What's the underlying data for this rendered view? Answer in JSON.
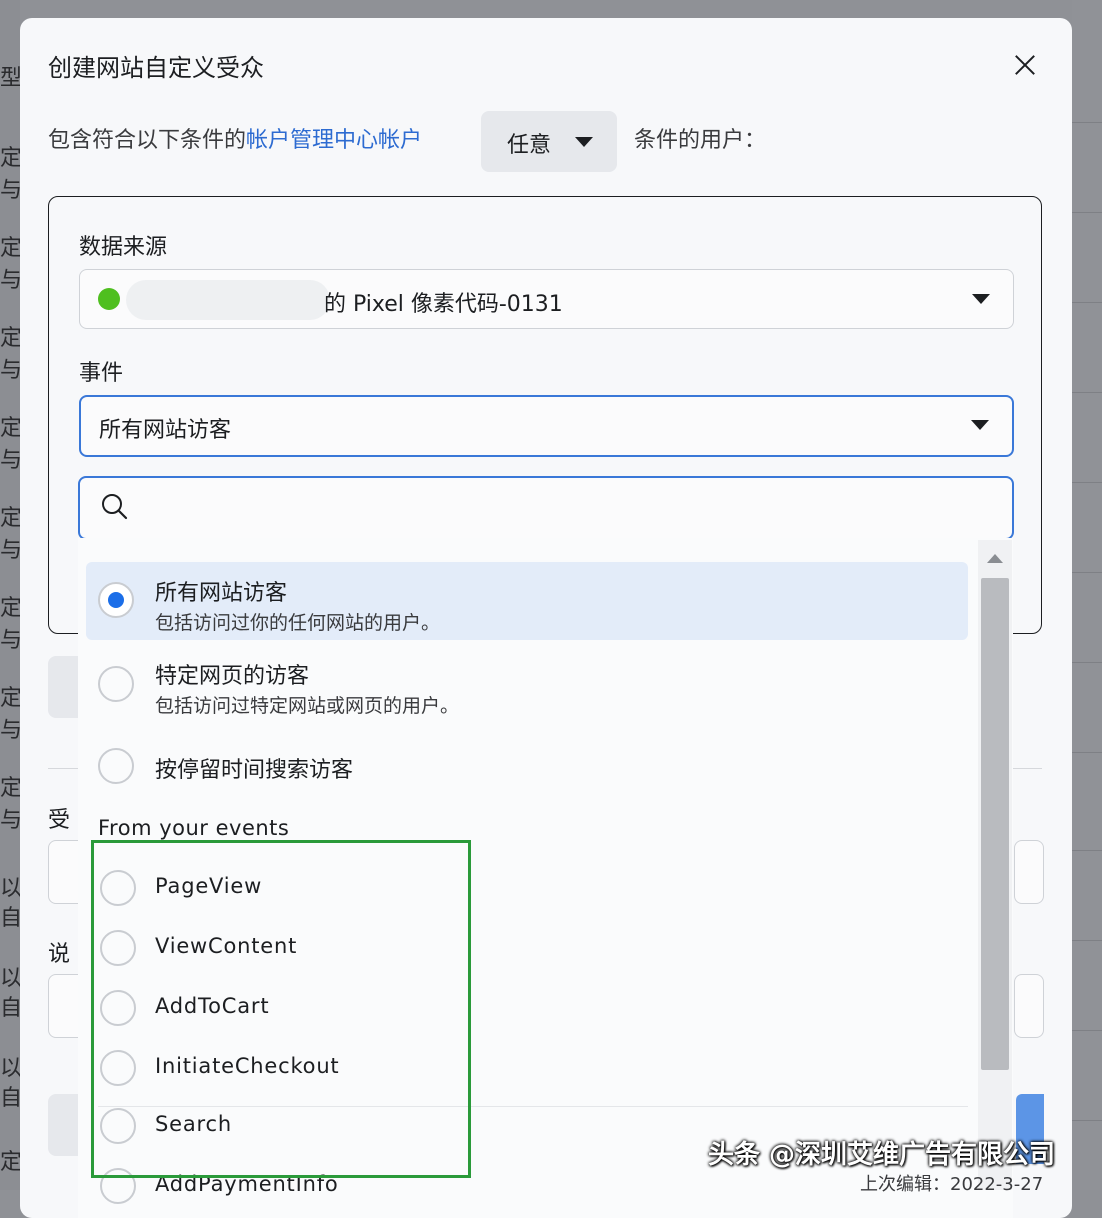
{
  "dialog": {
    "title": "创建网站自定义受众",
    "close_label": "×"
  },
  "include_rule": {
    "prefix": "包含符合以下条件的",
    "link": "帐户管理中心帐户",
    "match_value": "任意",
    "suffix": "条件的用户："
  },
  "source": {
    "label": "数据来源",
    "pixel_name": "的 Pixel 像素代码-0131",
    "status_color": "#4fbf1f"
  },
  "event": {
    "label": "事件",
    "selected": "所有网站访客",
    "search_placeholder": ""
  },
  "menu": {
    "options": [
      {
        "title": "所有网站访客",
        "desc": "包括访问过你的任何网站的用户。",
        "selected": true
      },
      {
        "title": "特定网页的访客",
        "desc": "包括访问过特定网站或网页的用户。",
        "selected": false
      },
      {
        "title": "按停留时间搜索访客",
        "desc": "",
        "selected": false
      }
    ],
    "section_header": "From your events",
    "events": [
      "PageView",
      "ViewContent",
      "AddToCart",
      "InitiateCheckout",
      "Search",
      "AddPaymentInfo"
    ]
  },
  "background": {
    "left_chars": [
      "型",
      "定",
      "与",
      "定",
      "与",
      "定",
      "与",
      "定",
      "与",
      "定",
      "与",
      "定",
      "与",
      "定",
      "与",
      "定",
      "与",
      "以",
      "自",
      "以",
      "自",
      "以",
      "自",
      "定"
    ],
    "behind_labels": [
      "受",
      "说"
    ],
    "footer_text": "上次编辑：2022-3-27"
  },
  "watermark": "头条 @深圳艾维广告有限公司",
  "colors": {
    "accent_blue": "#1b6ee8",
    "link_blue": "#2d6bd1",
    "highlight_green": "#2a9a3a"
  }
}
